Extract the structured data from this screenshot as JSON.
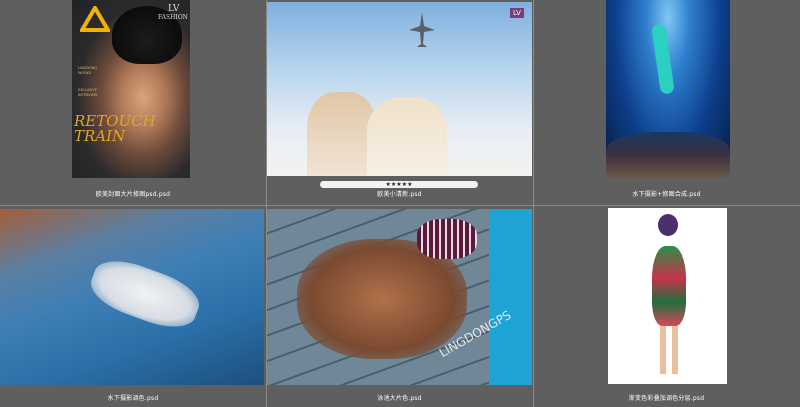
{
  "items": [
    {
      "caption": "欧美封面大片修图psd.psd",
      "cover": {
        "brand_letters": "LV",
        "brand_word": "FASHION",
        "headline": "RETOUCH TRAIN",
        "side_a": "LINGDONG WORKS",
        "side_b": "EXCLUSIVE INTERVIEW"
      }
    },
    {
      "caption": "欧美小清新.psd",
      "selected_rating": "★★★★★",
      "logo": "LV"
    },
    {
      "caption": "水下摄影+修图合成.psd"
    },
    {
      "caption": "水下摄影调色.psd"
    },
    {
      "caption": "泳池大片色.psd",
      "overlay": "LINGDONGPS"
    },
    {
      "caption": "渐变色彩叠加调色分层.psd"
    }
  ],
  "colors": {
    "background": "#5f5f5f",
    "divider": "#8a8a8a",
    "caption": "#ffffff"
  }
}
